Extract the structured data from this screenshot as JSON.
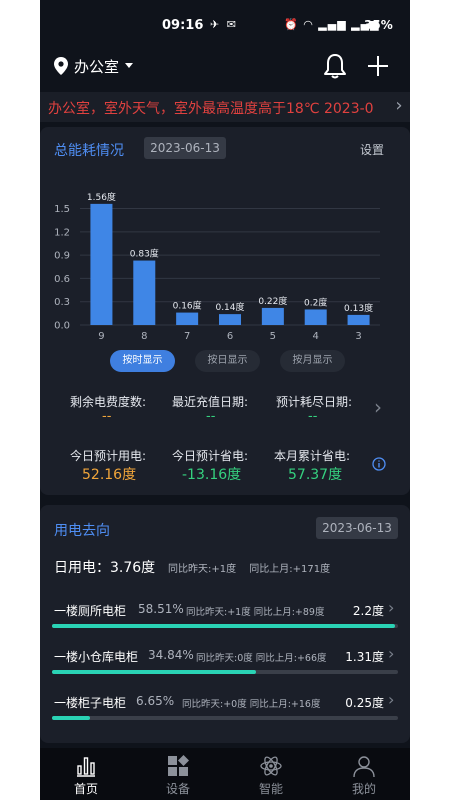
{
  "status_bar": {
    "time": "09:16",
    "battery": "35%"
  },
  "header": {
    "location": "办公室"
  },
  "marquee": {
    "text": "办公室，室外天气，室外最高温度高于18℃ 2023-0"
  },
  "energy_card": {
    "title": "总能耗情况",
    "date": "2023-06-13",
    "settings_label": "设置",
    "segments": {
      "hour": "按时显示",
      "day": "按日显示",
      "month": "按月显示"
    },
    "stats": {
      "remaining_label": "剩余电费度数:",
      "remaining_value": "--",
      "recharge_label": "最近充值日期:",
      "recharge_value": "--",
      "depletion_label": "预计耗尽日期:",
      "depletion_value": "--",
      "today_use_label": "今日预计用电:",
      "today_use_value": "52.16度",
      "today_save_label": "今日预计省电:",
      "today_save_value": "-13.16度",
      "month_total_label": "本月累计省电:",
      "month_total_value": "57.37度"
    },
    "colors": {
      "use": "#f0a53a",
      "save": "#35d07f",
      "total": "#35d07f",
      "bar": "#3f86e6"
    }
  },
  "chart_data": {
    "type": "bar",
    "categories": [
      "9",
      "8",
      "7",
      "6",
      "5",
      "4",
      "3"
    ],
    "values": [
      1.56,
      0.83,
      0.16,
      0.14,
      0.22,
      0.2,
      0.13
    ],
    "data_labels": [
      "1.56度",
      "0.83度",
      "0.16度",
      "0.14度",
      "0.22度",
      "0.2度",
      "0.13度"
    ],
    "y_ticks": [
      "0.0",
      "0.3",
      "0.6",
      "0.9",
      "1.2",
      "1.5"
    ],
    "ylim": [
      0,
      1.7
    ],
    "grid": true
  },
  "usage_card": {
    "title": "用电去向",
    "date": "2023-06-13",
    "daily_label": "日用电：3.76度",
    "daily_compare": "同比昨天:+1度 同比上月:+171度",
    "rows": [
      {
        "name": "一楼厕所电柜",
        "pct": "58.51%",
        "cmp": "同比昨天:+1度 同比上月:+89度",
        "value": "2.2度",
        "fraction": 0.99
      },
      {
        "name": "一楼小仓库电柜",
        "pct": "34.84%",
        "cmp": "同比昨天:0度 同比上月:+66度",
        "value": "1.31度",
        "fraction": 0.59
      },
      {
        "name": "一楼柜子电柜",
        "pct": "6.65%",
        "cmp": "同比昨天:+0度 同比上月:+16度",
        "value": "0.25度",
        "fraction": 0.11
      }
    ]
  },
  "nav": {
    "home": "首页",
    "devices": "设备",
    "smart": "智能",
    "mine": "我的"
  }
}
